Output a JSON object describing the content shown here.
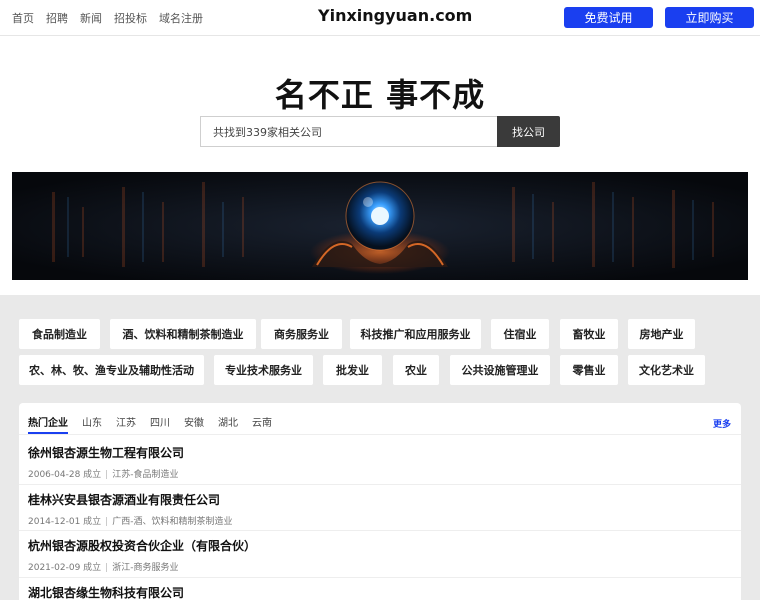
{
  "header": {
    "nav": [
      "首页",
      "招聘",
      "新闻",
      "招投标",
      "域名注册"
    ],
    "logo": "Yinxingyuan.com",
    "trial_label": "免费试用",
    "buy_label": "立即购买"
  },
  "hero": {
    "title": "名不正 事不成",
    "search_placeholder": "共找到339家相关公司",
    "search_button": "找公司"
  },
  "categories": [
    "食品制造业",
    "酒、饮料和精制茶制造业",
    "商务服务业",
    "科技推广和应用服务业",
    "住宿业",
    "畜牧业",
    "房地产业",
    "农、林、牧、渔专业及辅助性活动",
    "专业技术服务业",
    "批发业",
    "农业",
    "公共设施管理业",
    "零售业",
    "文化艺术业"
  ],
  "list": {
    "tabs": [
      "热门企业",
      "山东",
      "江苏",
      "四川",
      "安徽",
      "湖北",
      "云南"
    ],
    "more_label": "更多",
    "items": [
      {
        "name": "徐州银杏源生物工程有限公司",
        "date": "2006-04-28 成立",
        "info": "江苏-食品制造业"
      },
      {
        "name": "桂林兴安县银杏源酒业有限责任公司",
        "date": "2014-12-01 成立",
        "info": "广西-酒、饮料和精制茶制造业"
      },
      {
        "name": "杭州银杏源股权投资合伙企业（有限合伙）",
        "date": "2021-02-09 成立",
        "info": "浙江-商务服务业"
      },
      {
        "name": "湖北银杏缘生物科技有限公司",
        "date": "",
        "info": ""
      }
    ]
  },
  "colors": {
    "accent": "#1a3ff0",
    "section_bg": "#e9e9e9",
    "search_button_bg": "#3a3a3a"
  }
}
